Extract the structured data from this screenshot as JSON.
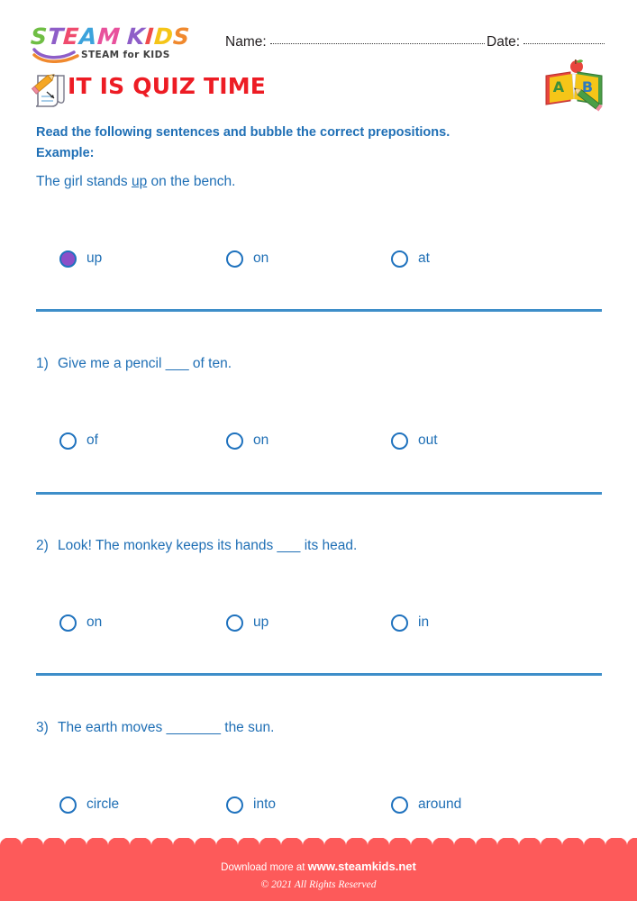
{
  "header": {
    "logo": {
      "letters": [
        "S",
        "T",
        "E",
        "A",
        "M",
        "K",
        "I",
        "D",
        "S"
      ],
      "tagline": "STEAM for KIDS"
    },
    "name_label": "Name:",
    "date_label": "Date:"
  },
  "title": {
    "text": "IT IS QUIZ TIME",
    "icon": "pencil-paper-icon",
    "right_icon": "abc-book-icon",
    "book_letters": [
      "A",
      "B"
    ]
  },
  "instructions": {
    "line1": "Read the following sentences and bubble the correct prepositions.",
    "line2": "Example:",
    "example_sentence_pre": "The girl stands ",
    "example_sentence_underlined": "up",
    "example_sentence_post": " on the bench."
  },
  "example": {
    "options": [
      {
        "label": "up",
        "selected": true
      },
      {
        "label": "on",
        "selected": false
      },
      {
        "label": "at",
        "selected": false
      }
    ]
  },
  "questions": [
    {
      "number": "1)",
      "text": "Give me a pencil ___ of ten.",
      "options": [
        {
          "label": "of",
          "selected": false
        },
        {
          "label": "on",
          "selected": false
        },
        {
          "label": "out",
          "selected": false
        }
      ]
    },
    {
      "number": "2)",
      "text": "Look! The monkey keeps its hands ___ its head.",
      "options": [
        {
          "label": "on",
          "selected": false
        },
        {
          "label": "up",
          "selected": false
        },
        {
          "label": "in",
          "selected": false
        }
      ]
    },
    {
      "number": "3)",
      "text": "The earth moves _______ the sun.",
      "options": [
        {
          "label": "circle",
          "selected": false
        },
        {
          "label": "into",
          "selected": false
        },
        {
          "label": "around",
          "selected": false
        }
      ]
    }
  ],
  "footer": {
    "download_prefix": "Download more at ",
    "site": "www.steamkids.net",
    "copyright": "© 2021 All Rights Reserved",
    "band_color": "#FD5A5A"
  },
  "colors": {
    "blue_text": "#1F6FB5",
    "bubble_border": "#1F72BE",
    "bubble_fill": "#8B4FC8",
    "divider": "#3E8EC9",
    "title_red": "#ED1C24"
  }
}
